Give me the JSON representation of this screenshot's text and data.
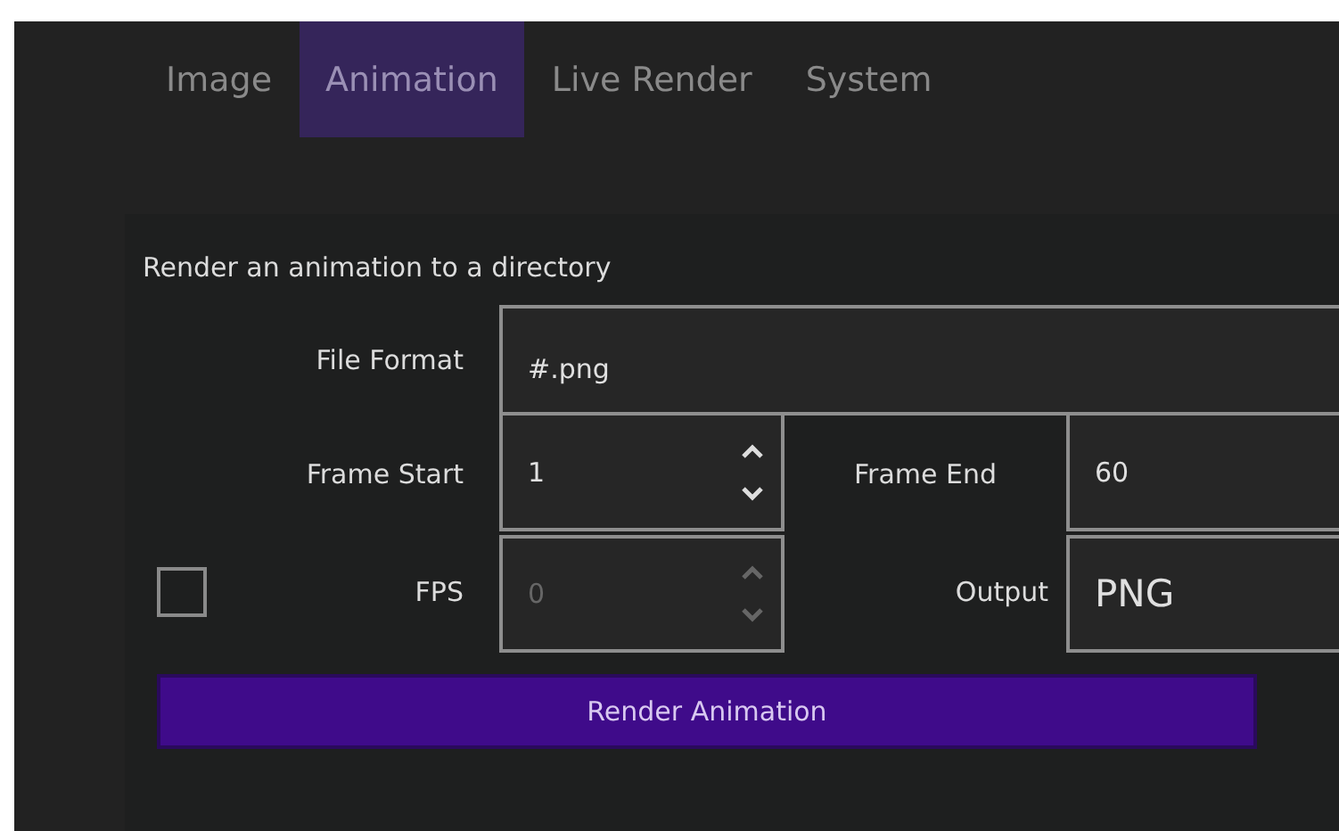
{
  "tabs": [
    {
      "label": "Image",
      "selected": false
    },
    {
      "label": "Animation",
      "selected": true
    },
    {
      "label": "Live Render",
      "selected": false
    },
    {
      "label": "System",
      "selected": false
    }
  ],
  "panel": {
    "heading": "Render an animation to a directory",
    "file_format": {
      "label": "File Format",
      "value": "#.png"
    },
    "frame_start": {
      "label": "Frame Start",
      "value": "1",
      "disabled": false
    },
    "frame_end": {
      "label": "Frame End",
      "value": "60"
    },
    "fps": {
      "label": "FPS",
      "value": "0",
      "disabled": true,
      "checked": false
    },
    "output": {
      "label": "Output",
      "value": "PNG"
    },
    "button": "Render Animation"
  }
}
